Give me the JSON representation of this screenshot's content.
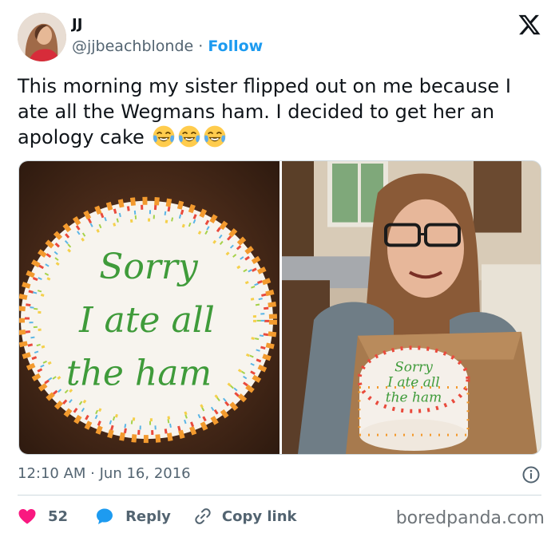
{
  "author": {
    "name": "JJ",
    "handle": "@jjbeachblonde",
    "separator": " · ",
    "follow_label": "Follow"
  },
  "tweet": {
    "text": "This morning my sister flipped out on me because I ate all the Wegmans ham. I decided to get her an apology cake",
    "emojis": [
      "face-with-tears-of-joy",
      "face-with-tears-of-joy",
      "face-with-tears-of-joy"
    ]
  },
  "media": {
    "left_photo": {
      "subject": "cake-closeup",
      "cake_text": [
        "Sorry",
        "I ate all",
        "the ham"
      ]
    },
    "right_photo": {
      "subject": "woman-holding-cake",
      "cake_text": [
        "Sorry",
        "I ate all",
        "the ham"
      ]
    }
  },
  "meta": {
    "time": "12:10 AM",
    "separator": " · ",
    "date": "Jun 16, 2016"
  },
  "actions": {
    "like_count": "52",
    "reply_label": "Reply",
    "copy_link_label": "Copy link"
  },
  "watermark": "boredpanda.com",
  "colors": {
    "link_blue": "#1d9bf0",
    "like_red": "#f91880",
    "muted_gray": "#536471"
  }
}
